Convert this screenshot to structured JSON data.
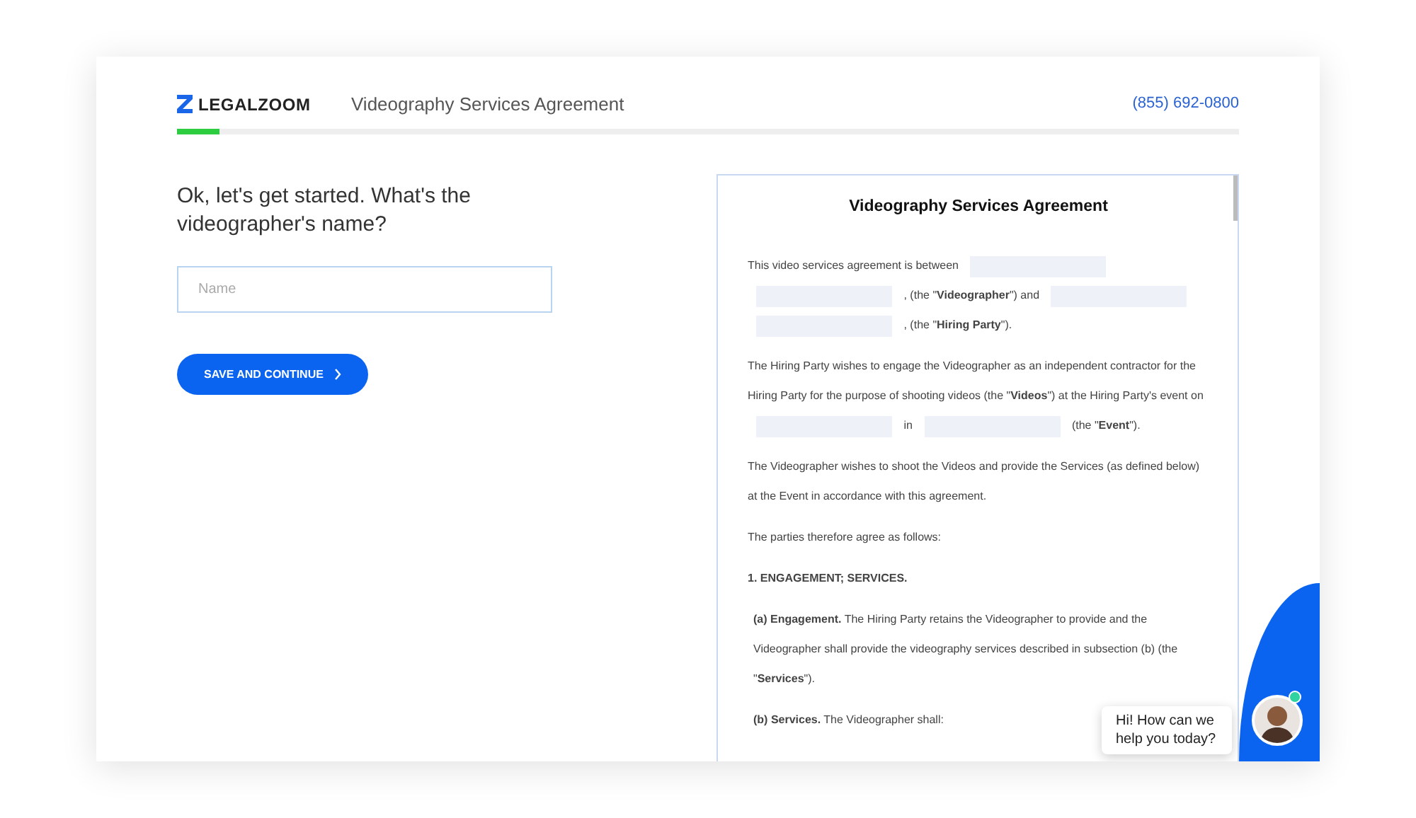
{
  "header": {
    "logo": "LEGALZOOM",
    "title": "Videography Services Agreement",
    "phone": "(855) 692-0800"
  },
  "progress": {
    "level": 0.04
  },
  "question": {
    "prompt": "Ok, let's get started. What's the videographer's name?",
    "placeholder": "Name",
    "button": "SAVE AND CONTINUE"
  },
  "document": {
    "title": "Videography Services Agreement",
    "paragraphs": [
      {
        "indent": false,
        "segments": [
          {
            "kind": "text",
            "text": "This video services agreement  is between"
          },
          {
            "kind": "blank"
          },
          {
            "kind": "blank"
          },
          {
            "kind": "text",
            "text": ", (the \"**Videographer**\") and"
          },
          {
            "kind": "blank"
          },
          {
            "kind": "blank"
          },
          {
            "kind": "text",
            "text": ", (the \"**Hiring Party**\")."
          }
        ]
      },
      {
        "indent": false,
        "segments": [
          {
            "kind": "text",
            "text": "The Hiring Party wishes to engage the Videographer as an independent contractor for the Hiring Party for the purpose of shooting videos (the \"**Videos**\") at the Hiring Party's event on"
          },
          {
            "kind": "blank"
          },
          {
            "kind": "text",
            "text": "in"
          },
          {
            "kind": "blank"
          },
          {
            "kind": "text",
            "text": "(the \"**Event**\")."
          }
        ]
      },
      {
        "indent": false,
        "segments": [
          {
            "kind": "text",
            "text": "The Videographer wishes to shoot the Videos and provide the Services (as defined below) at the Event in accordance with this agreement."
          }
        ]
      },
      {
        "indent": false,
        "segments": [
          {
            "kind": "text",
            "text": "The parties therefore agree as follows:"
          }
        ]
      },
      {
        "indent": false,
        "segments": [
          {
            "kind": "text",
            "text": "**1. ENGAGEMENT; SERVICES.**"
          }
        ]
      },
      {
        "indent": true,
        "segments": [
          {
            "kind": "text",
            "text": "**(a) Engagement.** The Hiring Party retains the Videographer to provide and the Videographer shall provide the videography services described in subsection (b) (the \"**Services**\")."
          }
        ]
      },
      {
        "indent": true,
        "segments": [
          {
            "kind": "text",
            "text": "**(b) Services.** The Videographer shall:"
          }
        ]
      }
    ]
  },
  "chat": {
    "message": "Hi! How can we help you today?",
    "online": true
  }
}
